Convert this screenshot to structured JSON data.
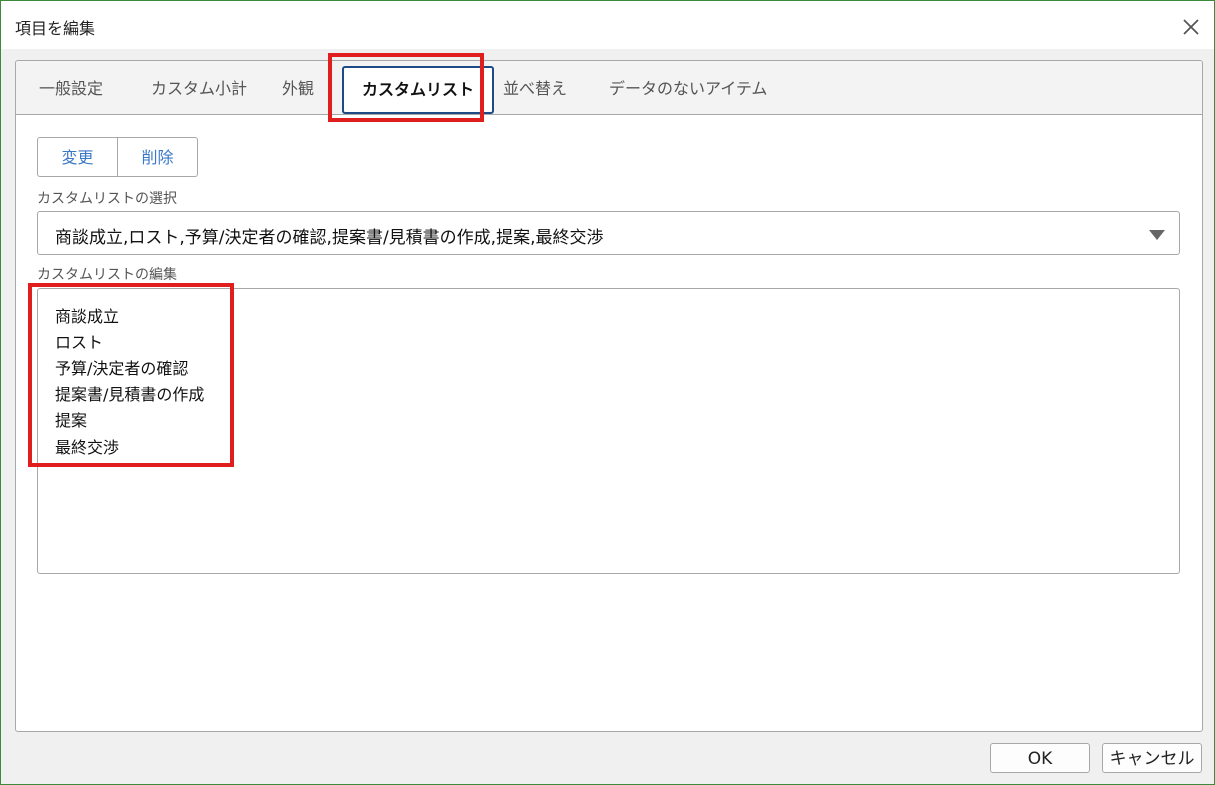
{
  "dialog": {
    "title": "項目を編集",
    "close_icon": "close-icon"
  },
  "tabs": [
    {
      "label": "一般設定",
      "active": false
    },
    {
      "label": "カスタム小計",
      "active": false
    },
    {
      "label": "外観",
      "active": false
    },
    {
      "label": "カスタムリスト",
      "active": true
    },
    {
      "label": "並べ替え",
      "active": false
    },
    {
      "label": "データのないアイテム",
      "active": false
    }
  ],
  "actions": {
    "change_label": "変更",
    "delete_label": "削除"
  },
  "custom_list_select": {
    "label": "カスタムリストの選択",
    "value": "商談成立,ロスト,予算/決定者の確認,提案書/見積書の作成,提案,最終交渉"
  },
  "custom_list_edit": {
    "label": "カスタムリストの編集",
    "lines": [
      "商談成立",
      "ロスト",
      "予算/決定者の確認",
      "提案書/見積書の作成",
      "提案",
      "最終交渉"
    ]
  },
  "footer": {
    "ok_label": "OK",
    "cancel_label": "キャンセル"
  },
  "colors": {
    "highlight": "#e01e1e",
    "accent_text": "#3a78c8",
    "active_tab_border": "#1e4a86",
    "window_border": "#3c8a3c"
  }
}
